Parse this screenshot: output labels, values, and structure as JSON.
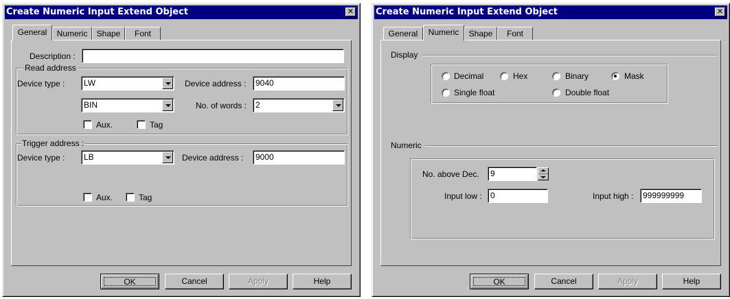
{
  "left_dialog": {
    "title": "Create Numeric Input Extend  Object",
    "tabs": [
      "General",
      "Numeric",
      "Shape",
      "Font"
    ],
    "active_tab": "General",
    "description_label": "Description :",
    "description_value": "",
    "read_address": {
      "group_label": "Read address",
      "device_type_label": "Device type :",
      "device_type_value": "LW",
      "device_address_label": "Device address :",
      "device_address_value": "9040",
      "format_value": "BIN",
      "words_label": "No. of words :",
      "words_value": "2",
      "aux_label": "Aux.",
      "tag_label": "Tag"
    },
    "trigger_address": {
      "group_label": "Trigger address :",
      "device_type_label": "Device type :",
      "device_type_value": "LB",
      "device_address_label": "Device  address :",
      "device_address_value": "9000",
      "aux_label": "Aux.",
      "tag_label": "Tag"
    },
    "buttons": {
      "ok": "OK",
      "cancel": "Cancel",
      "apply": "Apply",
      "help": "Help"
    }
  },
  "right_dialog": {
    "title": "Create Numeric Input Extend  Object",
    "tabs": [
      "General",
      "Numeric",
      "Shape",
      "Font"
    ],
    "active_tab": "Numeric",
    "display": {
      "group_label": "Display",
      "options": [
        "Decimal",
        "Hex",
        "Binary",
        "Mask",
        "Single float",
        "Double float"
      ],
      "selected": "Mask"
    },
    "numeric": {
      "group_label": "Numeric",
      "above_dec_label": "No. above Dec.",
      "above_dec_value": "9",
      "input_low_label": "Input low :",
      "input_low_value": "0",
      "input_high_label": "Input high :",
      "input_high_value": "999999999"
    },
    "buttons": {
      "ok": "OK",
      "cancel": "Cancel",
      "apply": "Apply",
      "help": "Help"
    }
  },
  "colors": {
    "titlebar": "#000080",
    "face": "#c0c0c0",
    "window": "#ffffff",
    "disabled_text": "#808080"
  },
  "icons": {
    "close": "close-icon",
    "combo_arrow": "chevron-down-icon",
    "spin": "spin-updown-icon"
  }
}
